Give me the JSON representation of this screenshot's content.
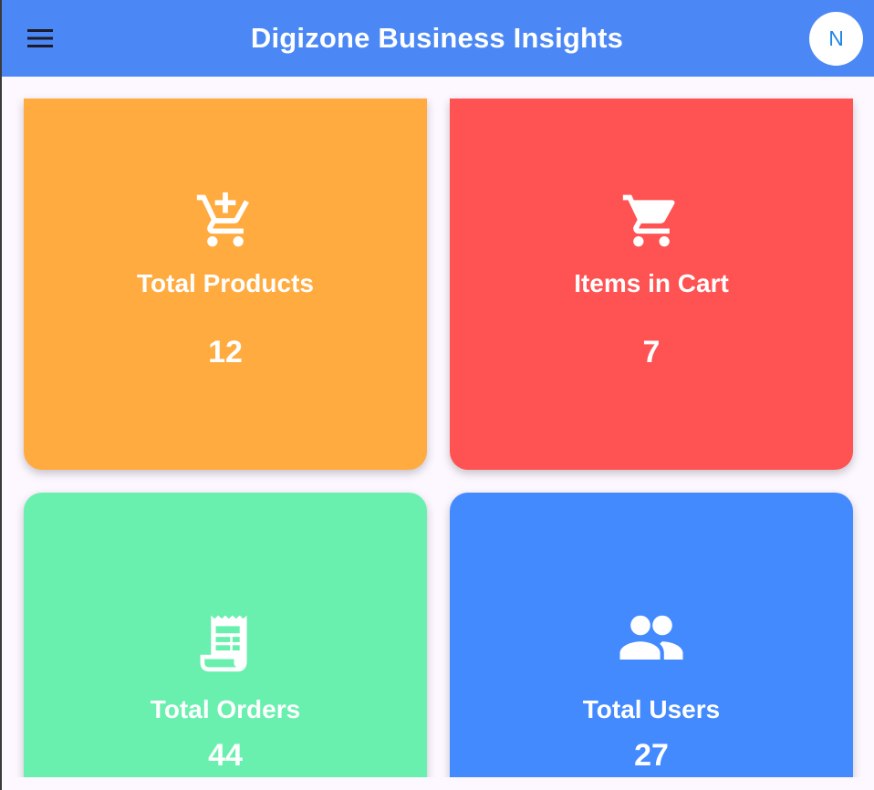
{
  "appbar": {
    "title": "Digizone Business Insights",
    "avatar_initial": "N",
    "menu_icon": "hamburger-menu-icon",
    "background_color": "#4b88f5"
  },
  "dashboard": {
    "cards": [
      {
        "label": "Total Products",
        "value": "12",
        "icon": "add-shopping-cart-icon",
        "color": "#ffab40"
      },
      {
        "label": "Items in Cart",
        "value": "7",
        "icon": "shopping-cart-icon",
        "color": "#ff5252"
      },
      {
        "label": "Total Orders",
        "value": "44",
        "icon": "receipt-icon",
        "color": "#69f0ae"
      },
      {
        "label": "Total Users",
        "value": "27",
        "icon": "people-icon",
        "color": "#448aff"
      }
    ]
  },
  "colors": {
    "page_background": "#fdf7ff",
    "avatar_text": "#1f87e6"
  }
}
